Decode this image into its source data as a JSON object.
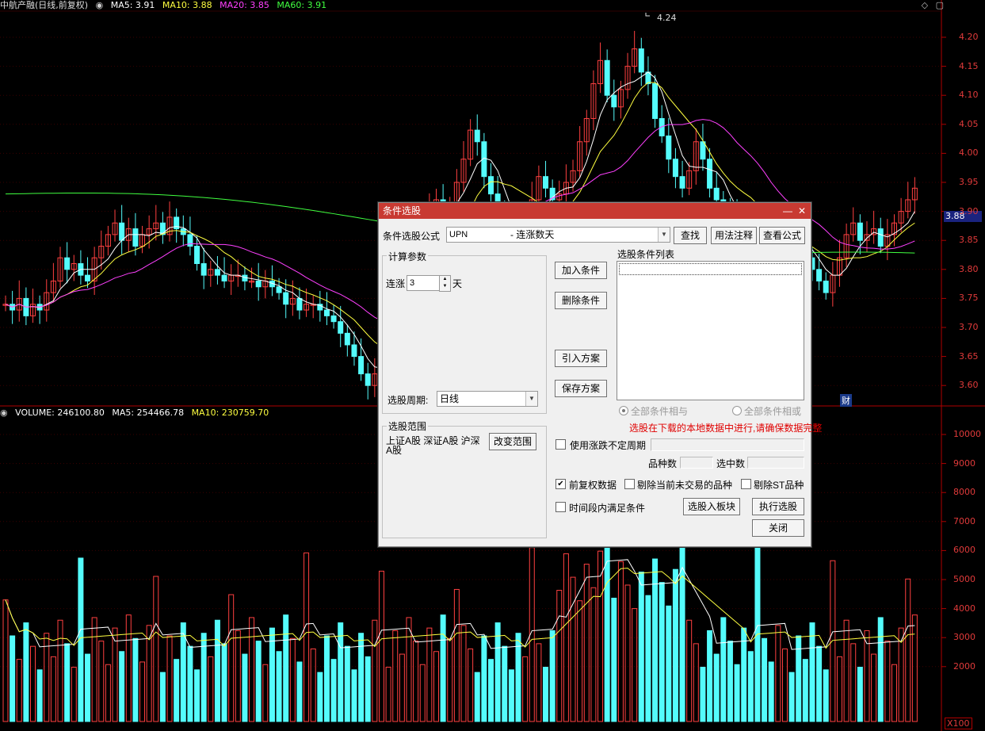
{
  "header": {
    "stock_name": "中航产融(日线,前复权)",
    "ma5": "MA5: 3.91",
    "ma10": "MA10: 3.88",
    "ma20": "MA20: 3.85",
    "ma60": "MA60: 3.91",
    "peak_label": "4.24",
    "current_price_badge": "3.88",
    "marker_cai": "财"
  },
  "volume_header": {
    "volume": "VOLUME: 246100.80",
    "ma5": "MA5: 254466.78",
    "ma10": "MA10: 230759.70"
  },
  "price_axis": [
    "4.20",
    "4.15",
    "4.10",
    "4.05",
    "4.00",
    "3.95",
    "3.90",
    "3.85",
    "3.80",
    "3.75",
    "3.70",
    "3.65",
    "3.60"
  ],
  "volume_axis": [
    "10000",
    "9000",
    "8000",
    "7000",
    "6000",
    "5000",
    "4000",
    "3000",
    "2000"
  ],
  "volume_unit": "X100",
  "colors": {
    "up": "#ff4040",
    "down": "#54fcfc",
    "ma5": "#ffffff",
    "ma10": "#ffff40",
    "ma20": "#ff40ff",
    "ma60": "#40ff40",
    "axis": "#b00000",
    "dialog_title": "#c83a32"
  },
  "dialog": {
    "title": "条件选股",
    "formula_label": "条件选股公式",
    "formula_value": "UPN",
    "formula_desc": "- 连涨数天",
    "btn_search": "查找",
    "btn_usage": "用法注释",
    "btn_view": "查看公式",
    "params_group": "计算参数",
    "param_label": "连涨",
    "param_value": "3",
    "param_unit": "天",
    "period_label": "选股周期:",
    "period_value": "日线",
    "btn_add": "加入条件",
    "btn_delete": "删除条件",
    "btn_import": "引入方案",
    "btn_save": "保存方案",
    "list_label": "选股条件列表",
    "radio_and": "全部条件相与",
    "radio_or": "全部条件相或",
    "warning": "选股在下载的本地数据中进行,请确保数据完整",
    "range_group": "选股范围",
    "range_text": "上证A股 深证A股 沪深A股",
    "btn_change_range": "改变范围",
    "chk_variable_period": "使用涨跌不定周期",
    "count_label": "品种数",
    "selected_label": "选中数",
    "chk_fq": "前复权数据",
    "chk_exclude_untraded": "剔除当前未交易的品种",
    "chk_exclude_st": "剔除ST品种",
    "chk_period_satisfy": "时间段内满足条件",
    "btn_to_block": "选股入板块",
    "btn_execute": "执行选股",
    "btn_close": "关闭"
  }
}
